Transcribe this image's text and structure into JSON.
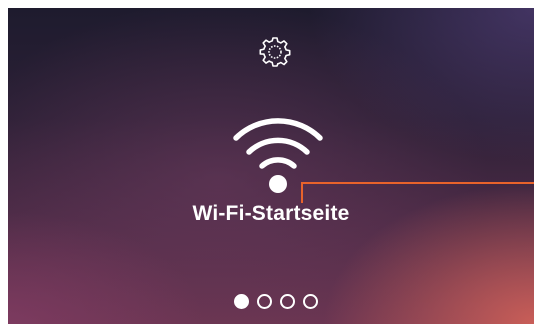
{
  "screen": {
    "title": "Wi-Fi-Startseite"
  },
  "icons": {
    "settings": "gear-icon",
    "main": "wifi-icon"
  },
  "pager": {
    "total_pages": 4,
    "current_page": 1
  },
  "colors": {
    "callout": "#e8632b",
    "foreground": "#ffffff"
  }
}
